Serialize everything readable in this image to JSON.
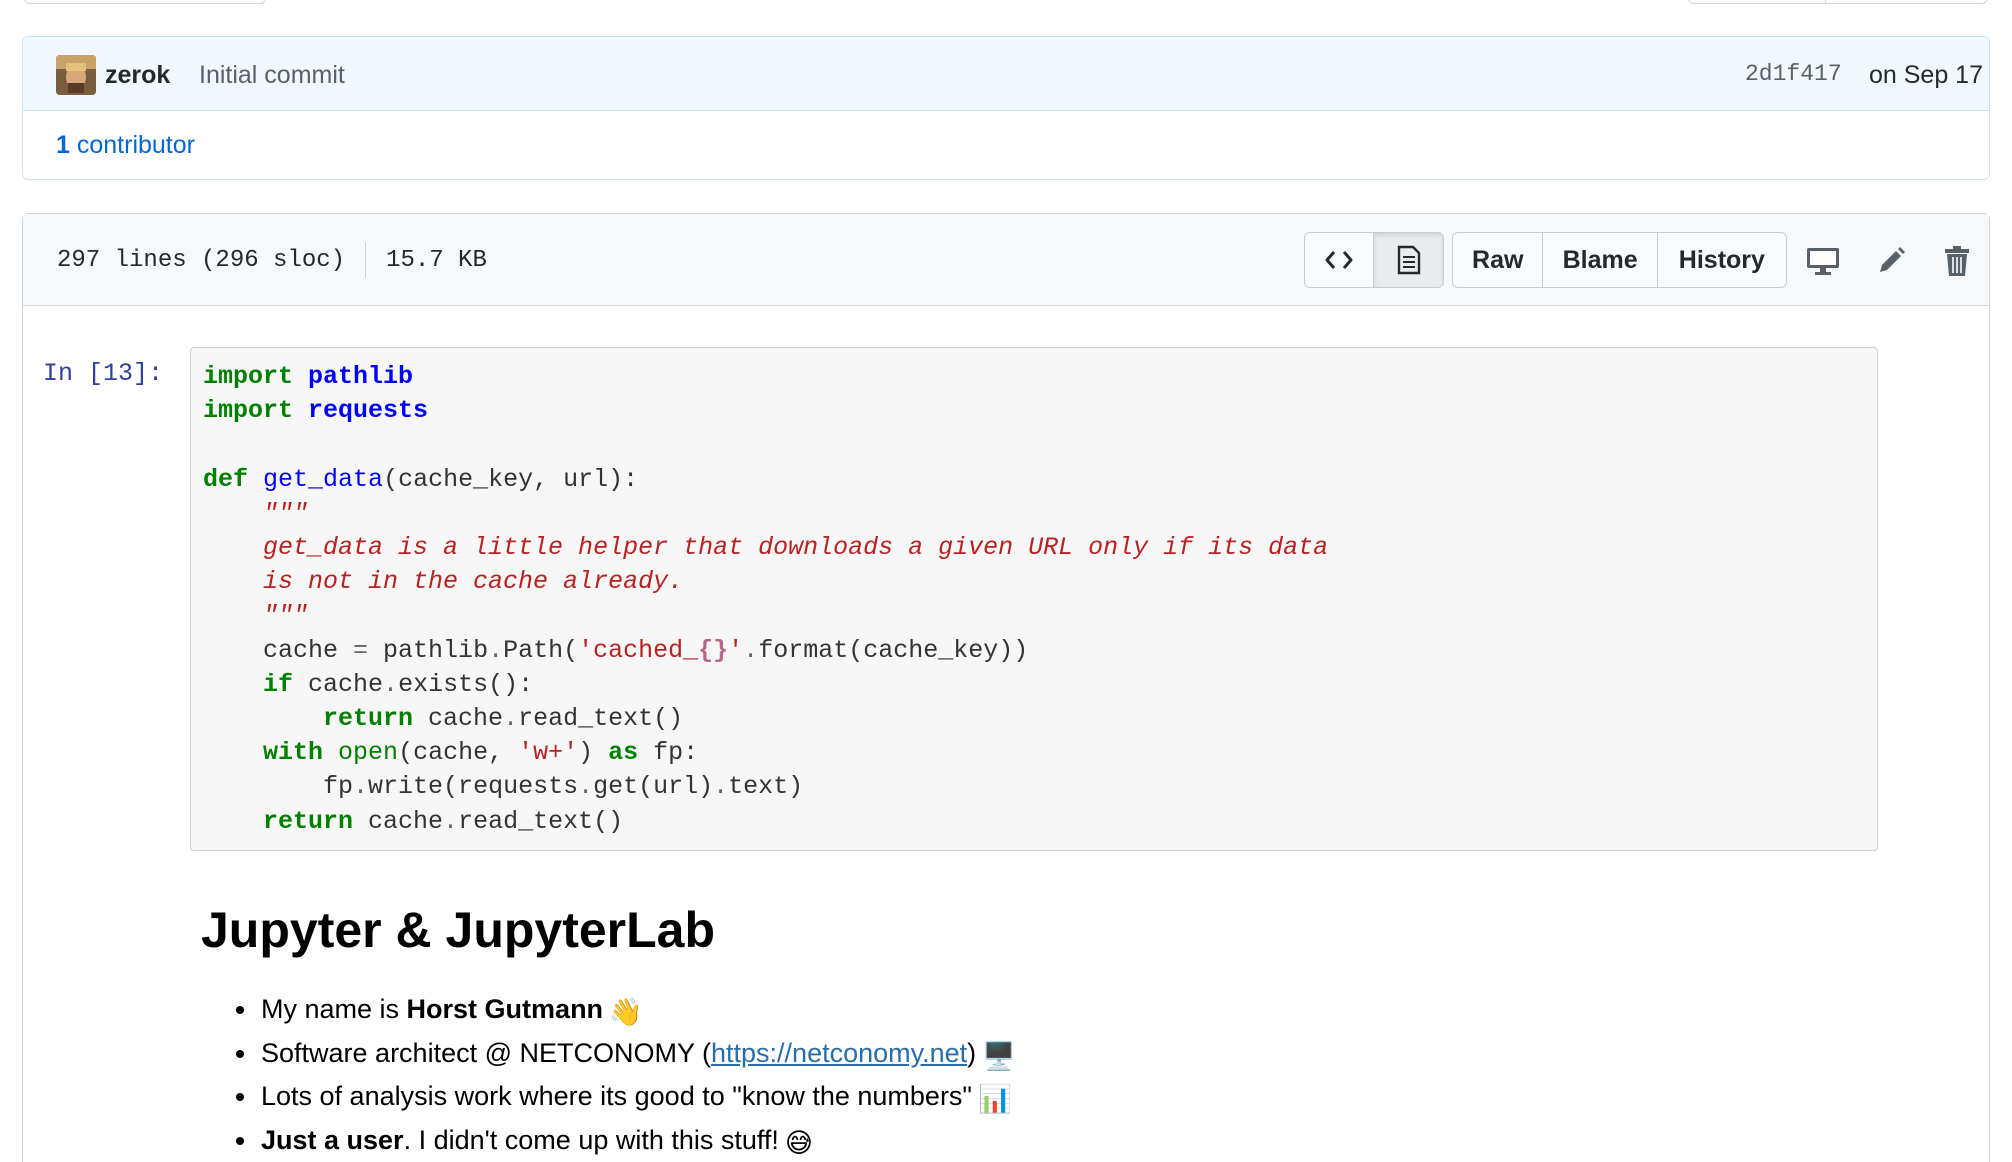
{
  "commit": {
    "author": "zerok",
    "message": "Initial commit",
    "sha": "2d1f417",
    "date": "on Sep 17",
    "contributors_count": "1",
    "contributors_label": "contributor"
  },
  "file": {
    "lines": "297 lines (296 sloc)",
    "size": "15.7 KB",
    "buttons": {
      "raw": "Raw",
      "blame": "Blame",
      "history": "History"
    },
    "icons": [
      "code-icon",
      "file-text-icon",
      "desktop-icon",
      "pencil-icon",
      "trash-icon"
    ]
  },
  "notebook": {
    "prompt": "In [13]:",
    "heading": "Jupyter & JupyterLab",
    "bullets": {
      "b1_text": "My name is ",
      "b1_bold": "Horst Gutmann",
      "b1_emoji": "👋",
      "b2_text": "Software architect @ NETCONOMY (",
      "b2_link": "https://netconomy.net",
      "b2_after": ")",
      "b2_emoji": "🖥️",
      "b3_text": "Lots of analysis work where its good to \"know the numbers\"",
      "b3_emoji": "📊",
      "b4_bold": "Just a user",
      "b4_text": ". I didn't come up with this stuff!",
      "b4_emoji": "😅"
    }
  },
  "colors": {
    "link": "#0366d6",
    "keyword": "#008000",
    "namespace": "#0000ff",
    "string": "#ba2121",
    "prompt": "#303f9f"
  }
}
